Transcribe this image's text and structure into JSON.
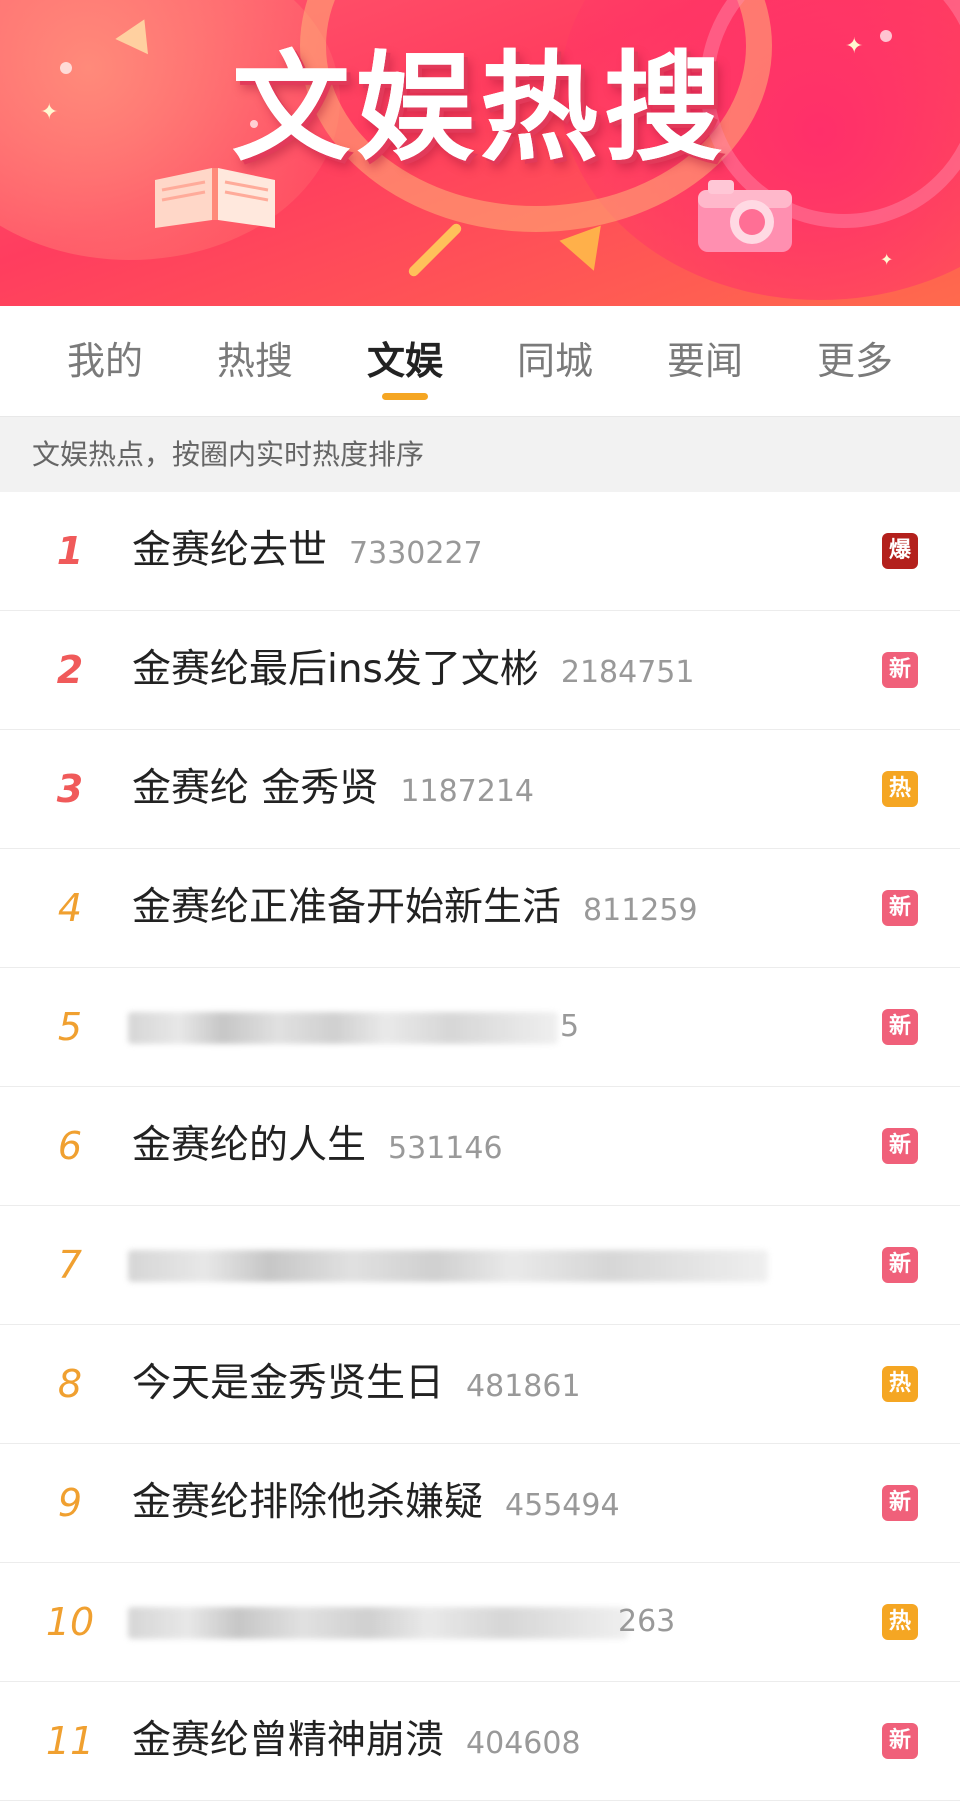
{
  "banner": {
    "title": "文娱热搜"
  },
  "tabs": [
    {
      "label": "我的",
      "active": false
    },
    {
      "label": "热搜",
      "active": false
    },
    {
      "label": "文娱",
      "active": true
    },
    {
      "label": "同城",
      "active": false
    },
    {
      "label": "要闻",
      "active": false
    },
    {
      "label": "更多",
      "active": false
    }
  ],
  "subheader": "文娱热点，按圈内实时热度排序",
  "badge_colors": {
    "爆": "#b3201c",
    "新": "#f0607a",
    "热": "#f5a623"
  },
  "items": [
    {
      "rank": "1",
      "title": "金赛纶去世",
      "count": "7330227",
      "badge": "爆",
      "blurred": false
    },
    {
      "rank": "2",
      "title": "金赛纶最后ins发了文彬",
      "count": "2184751",
      "badge": "新",
      "blurred": false
    },
    {
      "rank": "3",
      "title": "金赛纶 金秀贤",
      "count": "1187214",
      "badge": "热",
      "blurred": false
    },
    {
      "rank": "4",
      "title": "金赛纶正准备开始新生活",
      "count": "811259",
      "badge": "新",
      "blurred": false
    },
    {
      "rank": "5",
      "title": "",
      "count": "5",
      "badge": "新",
      "blurred": true
    },
    {
      "rank": "6",
      "title": "金赛纶的人生",
      "count": "531146",
      "badge": "新",
      "blurred": false
    },
    {
      "rank": "7",
      "title": "",
      "count": "",
      "badge": "新",
      "blurred": true
    },
    {
      "rank": "8",
      "title": "今天是金秀贤生日",
      "count": "481861",
      "badge": "热",
      "blurred": false
    },
    {
      "rank": "9",
      "title": "金赛纶排除他杀嫌疑",
      "count": "455494",
      "badge": "新",
      "blurred": false
    },
    {
      "rank": "10",
      "title": "",
      "count": "263",
      "badge": "热",
      "blurred": true
    },
    {
      "rank": "11",
      "title": "金赛纶曾精神崩溃",
      "count": "404608",
      "badge": "新",
      "blurred": false
    }
  ]
}
